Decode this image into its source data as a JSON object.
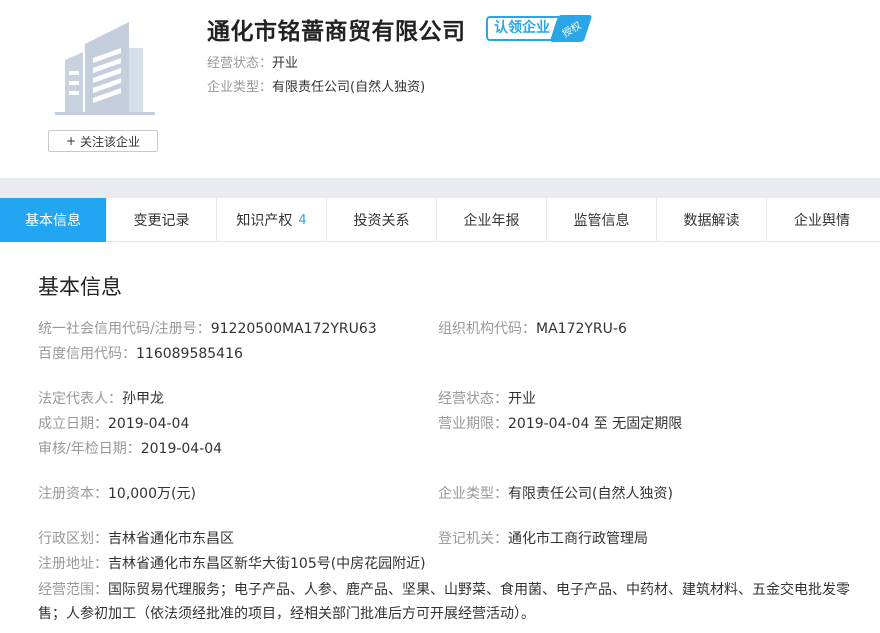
{
  "company": {
    "name": "通化市铭蔷商贸有限公司",
    "verify_badge": "认领企业",
    "verify_flag": "授权",
    "status_label": "经营状态：",
    "status_value": "开业",
    "type_label": "企业类型：",
    "type_value": "有限责任公司(自然人独资)",
    "follow_plus": "+",
    "follow_label": "关注该企业"
  },
  "tabs": [
    {
      "label": "基本信息",
      "count": ""
    },
    {
      "label": "变更记录",
      "count": ""
    },
    {
      "label": "知识产权",
      "count": "4"
    },
    {
      "label": "投资关系",
      "count": ""
    },
    {
      "label": "企业年报",
      "count": ""
    },
    {
      "label": "监管信息",
      "count": ""
    },
    {
      "label": "数据解读",
      "count": ""
    },
    {
      "label": "企业舆情",
      "count": ""
    }
  ],
  "basic": {
    "title": "基本信息",
    "credit_code_label": "统一社会信用代码/注册号：",
    "credit_code_value": "91220500MA172YRU63",
    "org_code_label": "组织机构代码：",
    "org_code_value": "MA172YRU-6",
    "baidu_code_label": "百度信用代码：",
    "baidu_code_value": "116089585416",
    "legal_rep_label": "法定代表人：",
    "legal_rep_value": "孙甲龙",
    "op_status_label": "经营状态：",
    "op_status_value": "开业",
    "found_date_label": "成立日期：",
    "found_date_value": "2019-04-04",
    "business_term_label": "营业期限：",
    "business_term_value": "2019-04-04 至 无固定期限",
    "approval_date_label": "审核/年检日期：",
    "approval_date_value": "2019-04-04",
    "reg_capital_label": "注册资本：",
    "reg_capital_value": "10,000万(元)",
    "ent_type_label": "企业类型：",
    "ent_type_value": "有限责任公司(自然人独资)",
    "region_label": "行政区划：",
    "region_value": "吉林省通化市东昌区",
    "reg_authority_label": "登记机关：",
    "reg_authority_value": "通化市工商行政管理局",
    "address_label": "注册地址：",
    "address_value": "吉林省通化市东昌区新华大街105号(中房花园附近)",
    "scope_label": "经营范围：",
    "scope_value": "国际贸易代理服务；电子产品、人参、鹿产品、坚果、山野菜、食用菌、电子产品、中药材、建筑材料、五金交电批发零售；人参初加工（依法须经批准的项目，经相关部门批准后方可开展经营活动）。"
  },
  "colors": {
    "accent": "#22a6f2",
    "band": "#e9ebf0",
    "label": "#999999",
    "text": "#333333"
  }
}
